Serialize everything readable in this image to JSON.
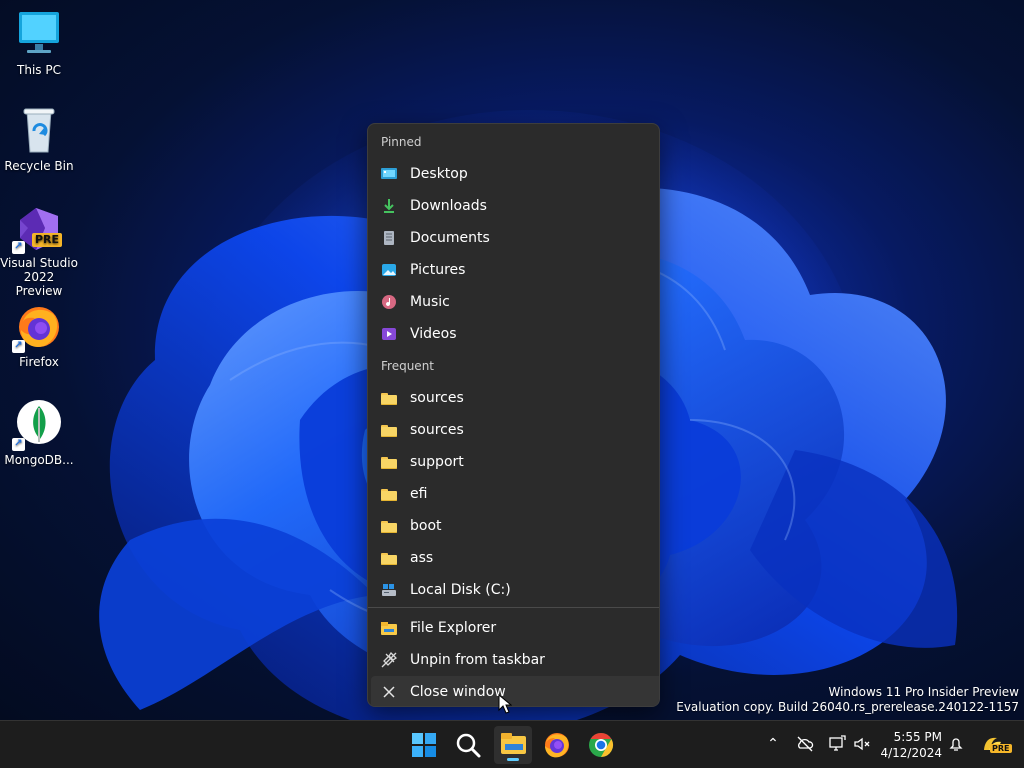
{
  "desktop": {
    "icons": [
      {
        "label": "This PC",
        "icon": "monitor-icon"
      },
      {
        "label": "Recycle Bin",
        "icon": "recycle-bin-icon"
      },
      {
        "label": "Visual Studio 2022 Preview",
        "icon": "visual-studio-icon",
        "badge": "PRE"
      },
      {
        "label": "Firefox",
        "icon": "firefox-icon"
      },
      {
        "label": "MongoDB...",
        "icon": "mongodb-icon"
      }
    ],
    "watermark": {
      "line1": "Windows 11 Pro Insider Preview",
      "line2": "Evaluation copy. Build 26040.rs_prerelease.240122-1157"
    }
  },
  "jumplist": {
    "pinned_title": "Pinned",
    "pinned": [
      {
        "label": "Desktop",
        "icon": "desktop-folder-icon"
      },
      {
        "label": "Downloads",
        "icon": "download-icon"
      },
      {
        "label": "Documents",
        "icon": "document-icon"
      },
      {
        "label": "Pictures",
        "icon": "pictures-icon"
      },
      {
        "label": "Music",
        "icon": "music-icon"
      },
      {
        "label": "Videos",
        "icon": "video-icon"
      }
    ],
    "frequent_title": "Frequent",
    "frequent": [
      {
        "label": "sources",
        "icon": "folder-icon"
      },
      {
        "label": "sources",
        "icon": "folder-icon"
      },
      {
        "label": "support",
        "icon": "folder-icon"
      },
      {
        "label": "efi",
        "icon": "folder-icon"
      },
      {
        "label": "boot",
        "icon": "folder-icon"
      },
      {
        "label": "ass",
        "icon": "folder-icon"
      },
      {
        "label": "Local Disk (C:)",
        "icon": "drive-icon"
      }
    ],
    "actions": [
      {
        "label": "File Explorer",
        "icon": "file-explorer-icon"
      },
      {
        "label": "Unpin from taskbar",
        "icon": "unpin-icon"
      },
      {
        "label": "Close window",
        "icon": "close-icon"
      }
    ]
  },
  "taskbar": {
    "apps": [
      {
        "name": "Start",
        "icon": "windows-icon"
      },
      {
        "name": "Search",
        "icon": "search-icon"
      },
      {
        "name": "File Explorer",
        "icon": "file-explorer-icon",
        "active": true
      },
      {
        "name": "Firefox",
        "icon": "firefox-icon"
      },
      {
        "name": "Chrome",
        "icon": "chrome-icon"
      }
    ],
    "tray": {
      "time": "5:55 PM",
      "date": "4/12/2024",
      "badge": "PRE"
    }
  },
  "colors": {
    "accent": "#60cdff",
    "menu_background": "#2b2b2b",
    "taskbar_background": "#1d1d1d",
    "folder": "#f8d565"
  }
}
